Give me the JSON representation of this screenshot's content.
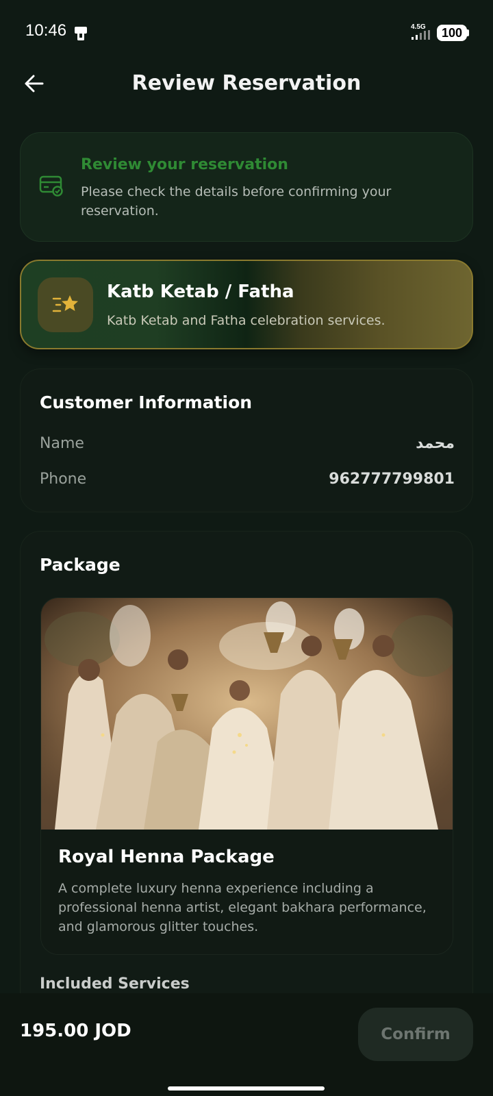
{
  "status_bar": {
    "time": "10:46",
    "network": "4.5G",
    "battery": "100"
  },
  "header": {
    "title": "Review Reservation"
  },
  "info_banner": {
    "title": "Review your reservation",
    "text": "Please check the details before confirming your reservation."
  },
  "category": {
    "title": "Katb Ketab / Fatha",
    "description": "Katb Ketab and Fatha celebration services."
  },
  "customer": {
    "section_title": "Customer Information",
    "name_label": "Name",
    "name_value": "محمد",
    "phone_label": "Phone",
    "phone_value": "962777799801"
  },
  "package": {
    "section_title": "Package",
    "name": "Royal Henna Package",
    "description": "A complete luxury henna experience including a professional henna artist, elegant bakhara performance, and glamorous glitter touches.",
    "included_title": "Included Services"
  },
  "footer": {
    "total": "195.00 JOD",
    "confirm_label": "Confirm"
  },
  "colors": {
    "background": "#0f1a14",
    "accent_green": "#2f8a34",
    "gold_border": "#8a7a2e",
    "star_gold": "#e2b33a"
  }
}
